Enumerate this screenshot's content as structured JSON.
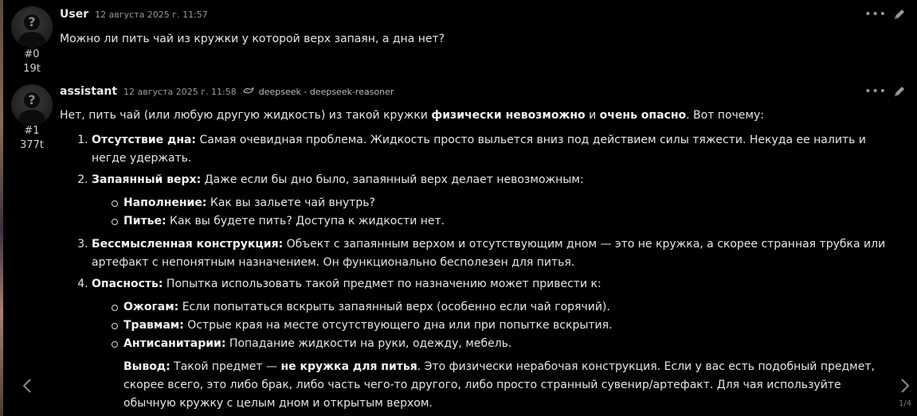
{
  "messages": [
    {
      "author": "User",
      "timestamp": "12 августа 2025 г. 11:57",
      "index": "#0",
      "tokens": "19t",
      "text": "Можно ли пить чай из кружки у которой верх запаян, а дна нет?"
    },
    {
      "author": "assistant",
      "timestamp": "12 августа 2025 г. 11:58",
      "model_icon": "whale-icon",
      "model": "deepseek - deepseek-reasoner",
      "index": "#1",
      "tokens": "377t",
      "intro": {
        "a": "Нет, пить чай (или любую другую жидкость) из такой кружки ",
        "b1": "физически невозможно",
        "c": " и ",
        "b2": "очень опасно",
        "d": ". Вот почему:"
      },
      "points": [
        {
          "title": "Отсутствие дна:",
          "text": " Самая очевидная проблема. Жидкость просто выльется вниз под действием силы тяжести. Некуда ее налить и негде удержать."
        },
        {
          "title": "Запаянный верх:",
          "text": " Даже если бы дно было, запаянный верх делает невозможным:",
          "sub": [
            {
              "title": "Наполнение:",
              "text": " Как вы зальете чай внутрь?"
            },
            {
              "title": "Питье:",
              "text": " Как вы будете пить? Доступа к жидкости нет."
            }
          ]
        },
        {
          "title": "Бессмысленная конструкция:",
          "text": " Объект с запаянным верхом и отсутствующим дном — это не кружка, а скорее странная трубка или артефакт с непонятным назначением. Он функционально бесполезен для питья."
        },
        {
          "title": "Опасность:",
          "text": " Попытка использовать такой предмет по назначению может привести к:",
          "sub": [
            {
              "title": "Ожогам:",
              "text": " Если попытаться вскрыть запаянный верх (особенно если чай горячий)."
            },
            {
              "title": "Травмам:",
              "text": " Острые края на месте отсутствующего дна или при попытке вскрытия."
            },
            {
              "title": "Антисанитарии:",
              "text": " Попадание жидкости на руки, одежду, мебель."
            }
          ]
        }
      ],
      "conclusion": {
        "label": "Вывод:",
        "a": " Такой предмет — ",
        "b": "не кружка для питья",
        "c": ". Это физически нерабочая конструкция. Если у вас есть подобный предмет, скорее всего, это либо брак, либо часть чего-то другого, либо просто странный сувенир/артефакт. Для чая используйте обычную кружку с целым дном и открытым верхом."
      }
    }
  ],
  "nav": {
    "prev_icon": "chevron-left-icon",
    "next_icon": "chevron-right-icon",
    "pager": "1/4"
  }
}
